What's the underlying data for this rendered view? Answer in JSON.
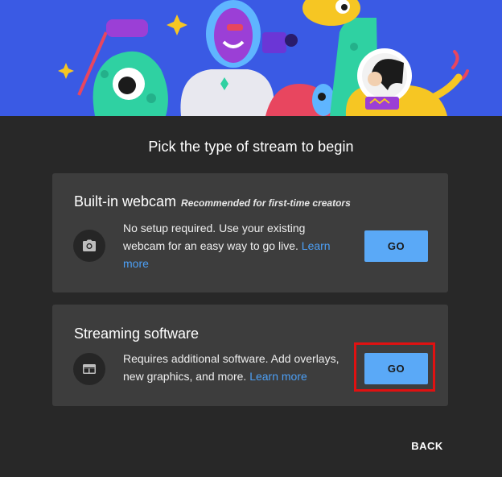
{
  "dialog": {
    "title": "Pick the type of stream to begin",
    "back_label": "BACK"
  },
  "cards": {
    "webcam": {
      "title": "Built-in webcam",
      "subtitle": "Recommended for first-time creators",
      "description": "No setup required. Use your existing webcam for an easy way to go live.",
      "link": "Learn more",
      "go_label": "GO",
      "icon": "camera-icon"
    },
    "software": {
      "title": "Streaming software",
      "description": "Requires additional software. Add overlays, new graphics, and more.",
      "link": "Learn more",
      "go_label": "GO",
      "icon": "layout-icon"
    }
  },
  "colors": {
    "hero_background": "#3a5ae4",
    "dialog_background": "#282828",
    "card_background": "#3d3d3d",
    "button_blue": "#5aa9f7",
    "link_blue": "#4c9ff5",
    "highlight_red": "#e01111"
  }
}
